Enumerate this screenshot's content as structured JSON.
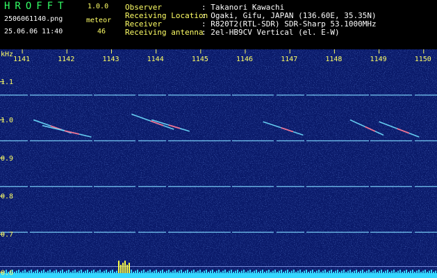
{
  "header": {
    "app_title": "HROFFT",
    "app_version": "1.0.0",
    "filename": "2506061140.png",
    "datetime": "25.06.06 11:40",
    "meteor_label": "meteor",
    "meteor_count": "46",
    "info": [
      {
        "label": "Observer",
        "value": ": Takanori Kawachi"
      },
      {
        "label": "Receiving Location",
        "value": ": Ogaki, Gifu, JAPAN (136.60E, 35.35N)"
      },
      {
        "label": "Receiver",
        "value": ": R820T2(RTL-SDR) SDR-Sharp 53.1000MHz"
      },
      {
        "label": "Receiving antenna",
        "value": ": 2el-HB9CV Vertical (el. E-W)"
      }
    ]
  },
  "spectrogram": {
    "y_unit": "kHz",
    "time_ticks": [
      "1141",
      "1142",
      "1143",
      "1144",
      "1145",
      "1146",
      "1147",
      "1148",
      "1149",
      "1150"
    ],
    "freq_ticks": [
      "1.1",
      "1.0",
      "0.9",
      "0.8",
      "0.7",
      "0.6"
    ],
    "freq_values": [
      1.1,
      1.0,
      0.9,
      0.8,
      0.7,
      0.6
    ],
    "freq_range": [
      0.585,
      1.185
    ],
    "time_range": [
      1140.5,
      1150.3
    ],
    "background_color": "#0a1a6a",
    "carrier_lines_khz": [
      1.065,
      0.945,
      0.825,
      0.705
    ],
    "meteor_echoes": [
      {
        "t0": 1141.25,
        "t1": 1142.1,
        "f0": 1.0,
        "f1": 0.965
      },
      {
        "t0": 1141.45,
        "t1": 1142.55,
        "f0": 0.985,
        "f1": 0.955
      },
      {
        "t0": 1143.45,
        "t1": 1144.4,
        "f0": 1.015,
        "f1": 0.975
      },
      {
        "t0": 1143.9,
        "t1": 1144.75,
        "f0": 1.0,
        "f1": 0.97
      },
      {
        "t0": 1146.4,
        "t1": 1147.3,
        "f0": 0.995,
        "f1": 0.96
      },
      {
        "t0": 1148.35,
        "t1": 1149.1,
        "f0": 1.0,
        "f1": 0.96
      },
      {
        "t0": 1149.0,
        "t1": 1149.9,
        "f0": 0.995,
        "f1": 0.955
      }
    ]
  }
}
